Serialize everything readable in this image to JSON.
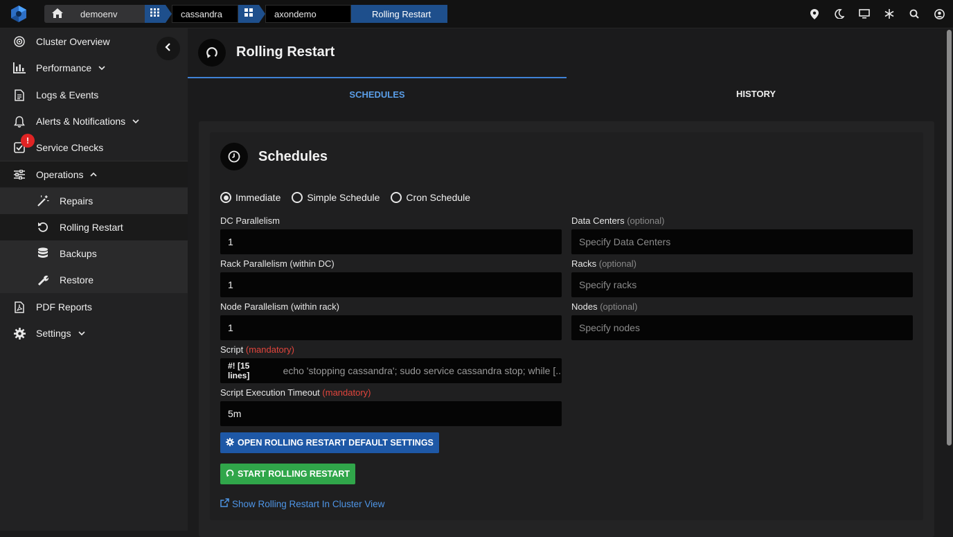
{
  "breadcrumb": {
    "items": [
      "demoenv",
      "cassandra",
      "axondemo",
      "Rolling Restart"
    ]
  },
  "sidebar": {
    "items": [
      {
        "label": "Cluster Overview"
      },
      {
        "label": "Performance"
      },
      {
        "label": "Logs & Events"
      },
      {
        "label": "Alerts & Notifications"
      },
      {
        "label": "Service Checks",
        "badge": "!"
      },
      {
        "label": "Operations"
      },
      {
        "label": "Repairs"
      },
      {
        "label": "Rolling Restart"
      },
      {
        "label": "Backups"
      },
      {
        "label": "Restore"
      },
      {
        "label": "PDF Reports"
      },
      {
        "label": "Settings"
      }
    ]
  },
  "page": {
    "title": "Rolling Restart",
    "tabs": [
      "SCHEDULES",
      "HISTORY"
    ]
  },
  "card": {
    "title": "Schedules",
    "radios": [
      "Immediate",
      "Simple Schedule",
      "Cron Schedule"
    ],
    "selected_radio": "Immediate",
    "fields": {
      "dc_parallelism": {
        "label": "DC Parallelism",
        "value": "1"
      },
      "rack_parallelism": {
        "label": "Rack Parallelism (within DC)",
        "value": "1"
      },
      "node_parallelism": {
        "label": "Node Parallelism (within rack)",
        "value": "1"
      },
      "script": {
        "label": "Script",
        "tag": "(mandatory)",
        "prefix": "#! [15 lines]",
        "value": "echo 'stopping cassandra'; sudo service cassandra stop; while [..."
      },
      "timeout": {
        "label": "Script Execution Timeout",
        "tag": "(mandatory)",
        "value": "5m"
      },
      "data_centers": {
        "label": "Data Centers",
        "tag": "(optional)",
        "placeholder": "Specify Data Centers"
      },
      "racks": {
        "label": "Racks",
        "tag": "(optional)",
        "placeholder": "Specify racks"
      },
      "nodes": {
        "label": "Nodes",
        "tag": "(optional)",
        "placeholder": "Specify nodes"
      }
    },
    "buttons": {
      "settings": "OPEN ROLLING RESTART DEFAULT SETTINGS",
      "start": "START ROLLING RESTART"
    },
    "link": "Show Rolling Restart In Cluster View"
  },
  "colors": {
    "accent_blue": "#1e58a6",
    "start_green": "#30a64a",
    "mandatory_red": "#e2453c",
    "badge_red": "#e02424"
  }
}
